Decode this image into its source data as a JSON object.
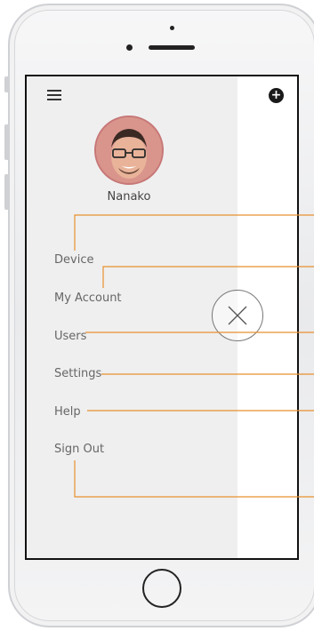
{
  "app": {
    "user": {
      "name": "Nanako"
    },
    "menu": {
      "items": [
        {
          "label": "Device"
        },
        {
          "label": "My Account"
        },
        {
          "label": "Users"
        },
        {
          "label": "Settings"
        },
        {
          "label": "Help"
        },
        {
          "label": "Sign Out"
        }
      ]
    },
    "icons": {
      "menu": "hamburger-icon",
      "add": "plus-circle-icon",
      "close": "close-icon"
    },
    "add_symbol": "+"
  },
  "colors": {
    "drawer_bg": "#efefef",
    "annotation": "#e8902f",
    "text": "#666666"
  }
}
